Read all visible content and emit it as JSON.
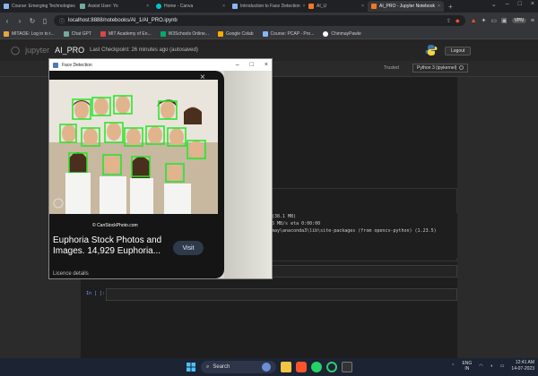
{
  "browser": {
    "tabs": [
      {
        "label": "Course: Emerging Technologies"
      },
      {
        "label": "Assist User: Yo"
      },
      {
        "label": "Home - Canva"
      },
      {
        "label": "Introduction to Face Detection"
      },
      {
        "label": "AI_U"
      },
      {
        "label": "AI_PRO - Jupyter Notebook",
        "active": true
      }
    ],
    "url": "localhost:8888/notebooks/AI_1/AI_PRO.ipynb",
    "vpn_label": "VPN",
    "bookmarks": [
      {
        "label": "MITAOE: Log in to t...",
        "color": "#e8a33d"
      },
      {
        "label": "Chat GPT",
        "color": "#74aa9c"
      },
      {
        "label": "MIT Academy of En...",
        "color": "#d44"
      },
      {
        "label": "W3Schools Online...",
        "color": "#04aa6d"
      },
      {
        "label": "Google Colab",
        "color": "#f9ab00"
      },
      {
        "label": "Course: PCAP - Pro...",
        "color": "#8ab4f8"
      },
      {
        "label": "ChinmayPawle",
        "color": "#ffffff"
      }
    ]
  },
  "jupyter": {
    "logo": "jupyter",
    "notebook_name": "AI_PRO",
    "checkpoint": "Last Checkpoint: 26 minutes ago  (autosaved)",
    "logout_label": "Logout",
    "trusted_label": "Trusted",
    "kernel_label": "Python 3 (ipykernel)",
    "output_lines": [
      "(38.1 MB)",
      "5 MB/s eta 0:00:00",
      "may\\anaconda3\\lib\\site-packages (from opencv-python) (1.23.5)"
    ],
    "prompt": "In [ ]:"
  },
  "face_window": {
    "title": "Face Detection",
    "stock_heading": "Euphoria Stock Photos and Images. 14,929 Euphoria...",
    "visit_label": "Visit",
    "licence_label": "Licence details",
    "watermark": "© CanStockPhoto.com",
    "detection_box_color": "#22e622"
  },
  "taskbar": {
    "search_label": "Search",
    "lang_top": "ENG",
    "lang_bottom": "IN",
    "time": "12:41 AM",
    "date": "14-07-2023"
  }
}
